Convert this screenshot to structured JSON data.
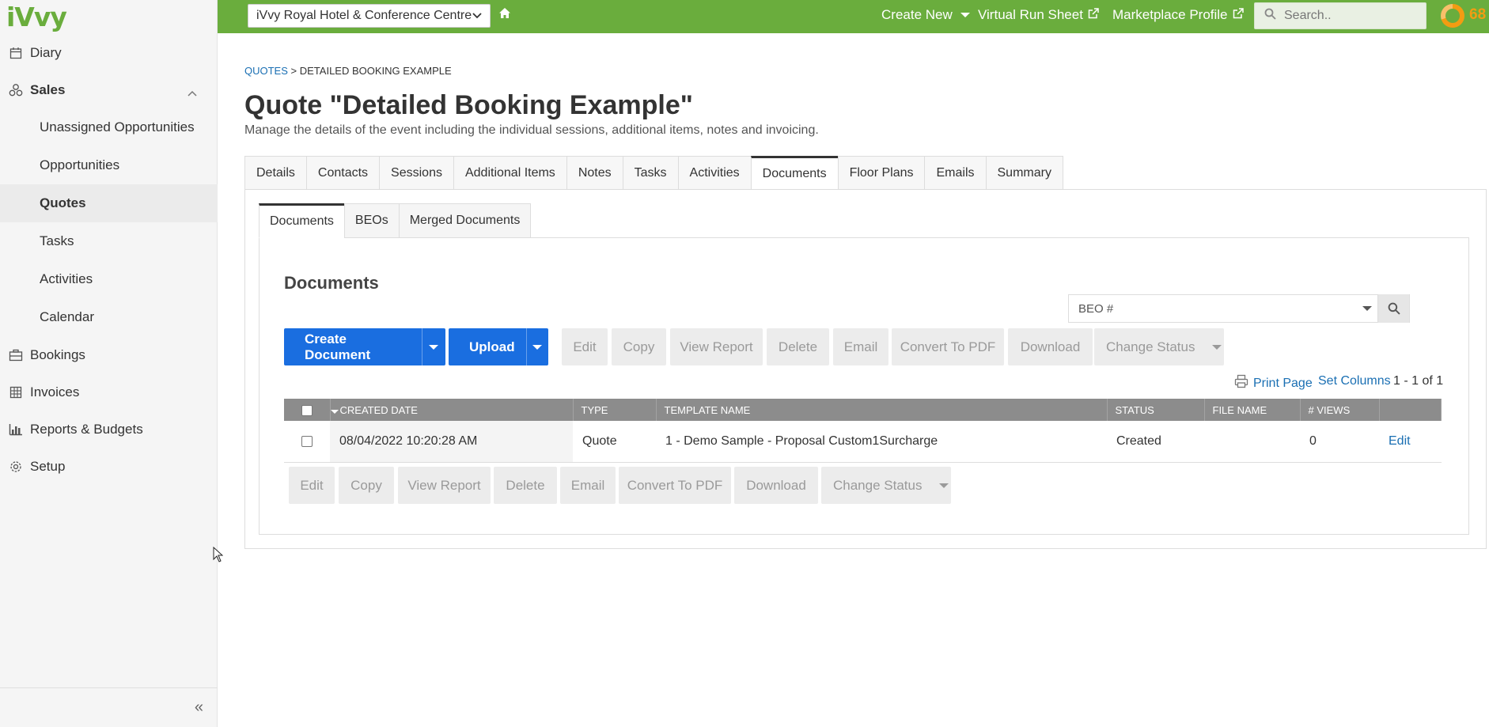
{
  "app": {
    "logo": "iVvy",
    "progress_value": "68"
  },
  "topbar": {
    "venue": "iVvy Royal Hotel & Conference Centre",
    "create_new": "Create New",
    "virtual_run_sheet": "Virtual Run Sheet",
    "marketplace_profile": "Marketplace Profile",
    "search_placeholder": "Search.."
  },
  "sidebar": {
    "items": [
      {
        "label": "Diary",
        "icon": "calendar-icon"
      },
      {
        "label": "Sales",
        "icon": "sales-icon"
      },
      {
        "label": "Bookings",
        "icon": "briefcase-icon"
      },
      {
        "label": "Invoices",
        "icon": "invoice-icon"
      },
      {
        "label": "Reports & Budgets",
        "icon": "chart-icon"
      },
      {
        "label": "Setup",
        "icon": "gear-icon"
      }
    ],
    "sales_sub": [
      "Unassigned Opportunities",
      "Opportunities",
      "Quotes",
      "Tasks",
      "Activities",
      "Calendar"
    ],
    "active_sub": "Quotes"
  },
  "breadcrumb": {
    "parent": "QUOTES",
    "separator": ">",
    "current": "DETAILED BOOKING EXAMPLE"
  },
  "page": {
    "title": "Quote \"Detailed Booking Example\"",
    "description": "Manage the details of the event including the individual sessions, additional items, notes and invoicing."
  },
  "tabs": [
    "Details",
    "Contacts",
    "Sessions",
    "Additional Items",
    "Notes",
    "Tasks",
    "Activities",
    "Documents",
    "Floor Plans",
    "Emails",
    "Summary"
  ],
  "active_tab": "Documents",
  "subtabs": [
    "Documents",
    "BEOs",
    "Merged Documents"
  ],
  "active_subtab": "Documents",
  "documents": {
    "title": "Documents",
    "beo_placeholder": "BEO #",
    "create_label": "Create Document",
    "upload_label": "Upload",
    "actions": [
      "Edit",
      "Copy",
      "View Report",
      "Delete",
      "Email",
      "Convert To PDF",
      "Download",
      "Change Status"
    ],
    "print_page": "Print Page",
    "set_columns": "Set Columns",
    "count": "1 - 1 of 1",
    "columns": [
      "CREATED DATE",
      "TYPE",
      "TEMPLATE NAME",
      "STATUS",
      "FILE NAME",
      "# VIEWS"
    ],
    "rows": [
      {
        "created": "08/04/2022 10:20:28 AM",
        "type": "Quote",
        "template": "1 - Demo Sample - Proposal Custom1Surcharge",
        "status": "Created",
        "file": "",
        "views": "0",
        "edit": "Edit"
      }
    ]
  },
  "colors": {
    "brand_green": "#6aad3d",
    "primary_blue": "#1a6ee0",
    "link_blue": "#1a6fb3",
    "header_grey": "#8c8c8c"
  }
}
